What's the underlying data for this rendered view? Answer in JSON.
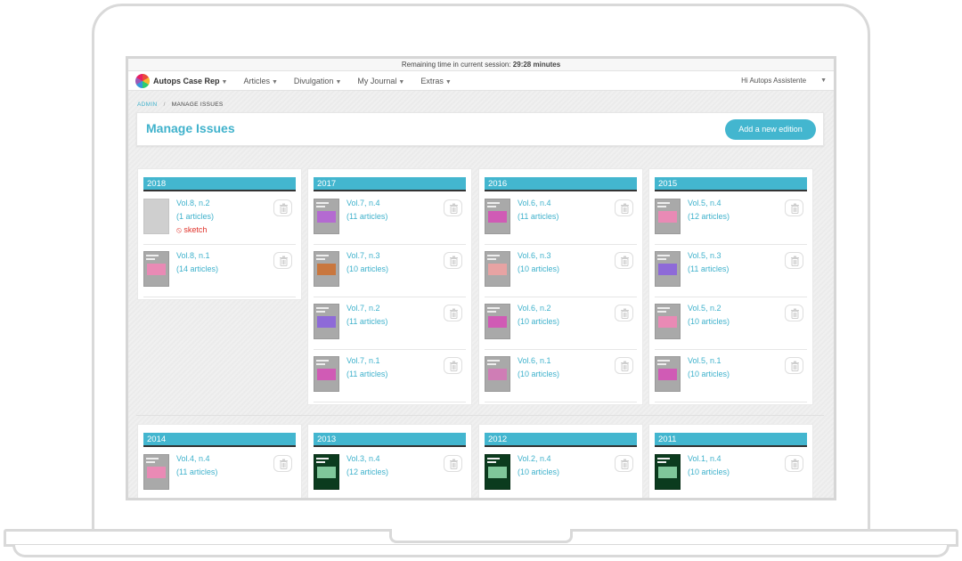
{
  "session": {
    "label": "Remaining time in current session:",
    "time": "29:28 minutes"
  },
  "navbar": {
    "brand": "Autops Case Rep",
    "items": [
      "Articles",
      "Divulgation",
      "My Journal",
      "Extras"
    ],
    "user": "Hi Autops Assistente"
  },
  "breadcrumb": {
    "root": "ADMIN",
    "separator": "/",
    "current": "MANAGE ISSUES"
  },
  "page": {
    "title": "Manage Issues",
    "add_button": "Add a new edition"
  },
  "years": [
    {
      "year": "2018",
      "issues": [
        {
          "title": "Vol.8, n.2",
          "count": "(1 articles)",
          "status": "sketch",
          "cover": "blank"
        },
        {
          "title": "Vol.8, n.1",
          "count": "(14 articles)",
          "cover": "pink"
        }
      ]
    },
    {
      "year": "2017",
      "issues": [
        {
          "title": "Vol.7, n.4",
          "count": "(11 articles)",
          "cover": "purple"
        },
        {
          "title": "Vol.7, n.3",
          "count": "(10 articles)",
          "cover": "orange"
        },
        {
          "title": "Vol.7, n.2",
          "count": "(11 articles)",
          "cover": "violet"
        },
        {
          "title": "Vol.7, n.1",
          "count": "(11 articles)",
          "cover": "magenta"
        }
      ]
    },
    {
      "year": "2016",
      "issues": [
        {
          "title": "Vol.6, n.4",
          "count": "(11 articles)",
          "cover": "magenta"
        },
        {
          "title": "Vol.6, n.3",
          "count": "(10 articles)",
          "cover": "salmon"
        },
        {
          "title": "Vol.6, n.2",
          "count": "(10 articles)",
          "cover": "magenta"
        },
        {
          "title": "Vol.6, n.1",
          "count": "(10 articles)",
          "cover": "rose"
        }
      ]
    },
    {
      "year": "2015",
      "issues": [
        {
          "title": "Vol.5, n.4",
          "count": "(12 articles)",
          "cover": "pink"
        },
        {
          "title": "Vol.5, n.3",
          "count": "(11 articles)",
          "cover": "violet"
        },
        {
          "title": "Vol.5, n.2",
          "count": "(10 articles)",
          "cover": "pink"
        },
        {
          "title": "Vol.5, n.1",
          "count": "(10 articles)",
          "cover": "magenta"
        }
      ]
    },
    {
      "year": "2014",
      "issues": [
        {
          "title": "Vol.4, n.4",
          "count": "(11 articles)",
          "cover": "pink"
        }
      ]
    },
    {
      "year": "2013",
      "issues": [
        {
          "title": "Vol.3, n.4",
          "count": "(12 articles)",
          "cover": "green"
        }
      ]
    },
    {
      "year": "2012",
      "issues": [
        {
          "title": "Vol.2, n.4",
          "count": "(10 articles)",
          "cover": "green"
        }
      ]
    },
    {
      "year": "2011",
      "issues": [
        {
          "title": "Vol.1, n.4",
          "count": "(10 articles)",
          "cover": "green"
        }
      ]
    }
  ],
  "colors": {
    "accent": "#43b6cf",
    "link": "#40b2cc",
    "sketch": "#e0322a",
    "cover_tints": {
      "pink": "#e98ab5",
      "purple": "#b46ad1",
      "orange": "#c9773f",
      "violet": "#8e6ad8",
      "magenta": "#d05bb5",
      "salmon": "#e7a3a3",
      "rose": "#cf7db5",
      "green": "#7fc79a"
    }
  }
}
